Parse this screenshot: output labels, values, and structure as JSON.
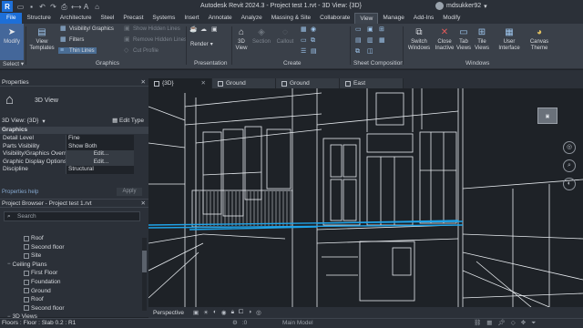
{
  "titlebar": {
    "app_letter": "R",
    "title": "Autodesk Revit 2024.3 - Project test 1.rvt - 3D View: {3D}",
    "user": "mdsukker92"
  },
  "ribbon_tabs": [
    "File",
    "Structure",
    "Architecture",
    "Steel",
    "Precast",
    "Systems",
    "Insert",
    "Annotate",
    "Analyze",
    "Massing & Site",
    "Collaborate",
    "View",
    "Manage",
    "Add-Ins",
    "Modify"
  ],
  "active_ribbon_tab": "View",
  "ribbon": {
    "modify": "Modify",
    "select": "Select ▾",
    "view_templates": "View Templates",
    "visibility_graphics": "Visibility/ Graphics",
    "filters": "Filters",
    "thin_lines": "Thin Lines",
    "show_hidden_lines": "Show Hidden Lines",
    "remove_hidden_lines": "Remove Hidden Lines",
    "cut_profile": "Cut Profile",
    "graphics_label": "Graphics",
    "render": "Render",
    "presentation_label": "Presentation",
    "view_3d": "3D View",
    "section": "Section",
    "callout": "Callout",
    "create_label": "Create",
    "sheet_composition_label": "Sheet Composition",
    "switch_windows": "Switch Windows",
    "close_inactive": "Close Inactive",
    "tab_views": "Tab Views",
    "tile_views": "Tile Views",
    "user_interface": "User Interface",
    "canvas_theme": "Canvas Theme",
    "windows_label": "Windows"
  },
  "properties": {
    "header": "Properties",
    "type_name": "3D View",
    "view_selector": "3D View: {3D}",
    "edit_type": "Edit Type",
    "category": "Graphics",
    "rows": [
      {
        "key": "Detail Level",
        "value": "Fine"
      },
      {
        "key": "Parts Visibility",
        "value": "Show Both"
      },
      {
        "key": "Visibility/Graphics Overr...",
        "value": "Edit..."
      },
      {
        "key": "Graphic Display Options",
        "value": "Edit..."
      },
      {
        "key": "Discipline",
        "value": "Structural"
      }
    ],
    "help_link": "Properties help",
    "apply": "Apply"
  },
  "browser": {
    "header": "Project Browser - Project test 1.rvt",
    "search_placeholder": "Search",
    "items": [
      {
        "label": "Roof",
        "level": 3
      },
      {
        "label": "Second floor",
        "level": 3
      },
      {
        "label": "Site",
        "level": 3
      },
      {
        "label": "Ceiling Plans",
        "level": 1
      },
      {
        "label": "First Floor",
        "level": 3
      },
      {
        "label": "Foundation",
        "level": 3
      },
      {
        "label": "Ground",
        "level": 3
      },
      {
        "label": "Roof",
        "level": 3
      },
      {
        "label": "Second floor",
        "level": 3
      },
      {
        "label": "3D Views",
        "level": 1
      }
    ]
  },
  "view_tabs": [
    {
      "label": "{3D}",
      "active": true
    },
    {
      "label": "Ground",
      "active": false
    },
    {
      "label": "Ground",
      "active": false
    },
    {
      "label": "East",
      "active": false
    }
  ],
  "view_control": {
    "mode": "Perspective"
  },
  "status": {
    "text": "Floors : Floor : Slab 0.2 : R1",
    "main_model": "Main Model",
    "zero": ":0"
  },
  "colors": {
    "accent": "#1d6fd8",
    "selection_highlight": "#1fa3e8"
  }
}
